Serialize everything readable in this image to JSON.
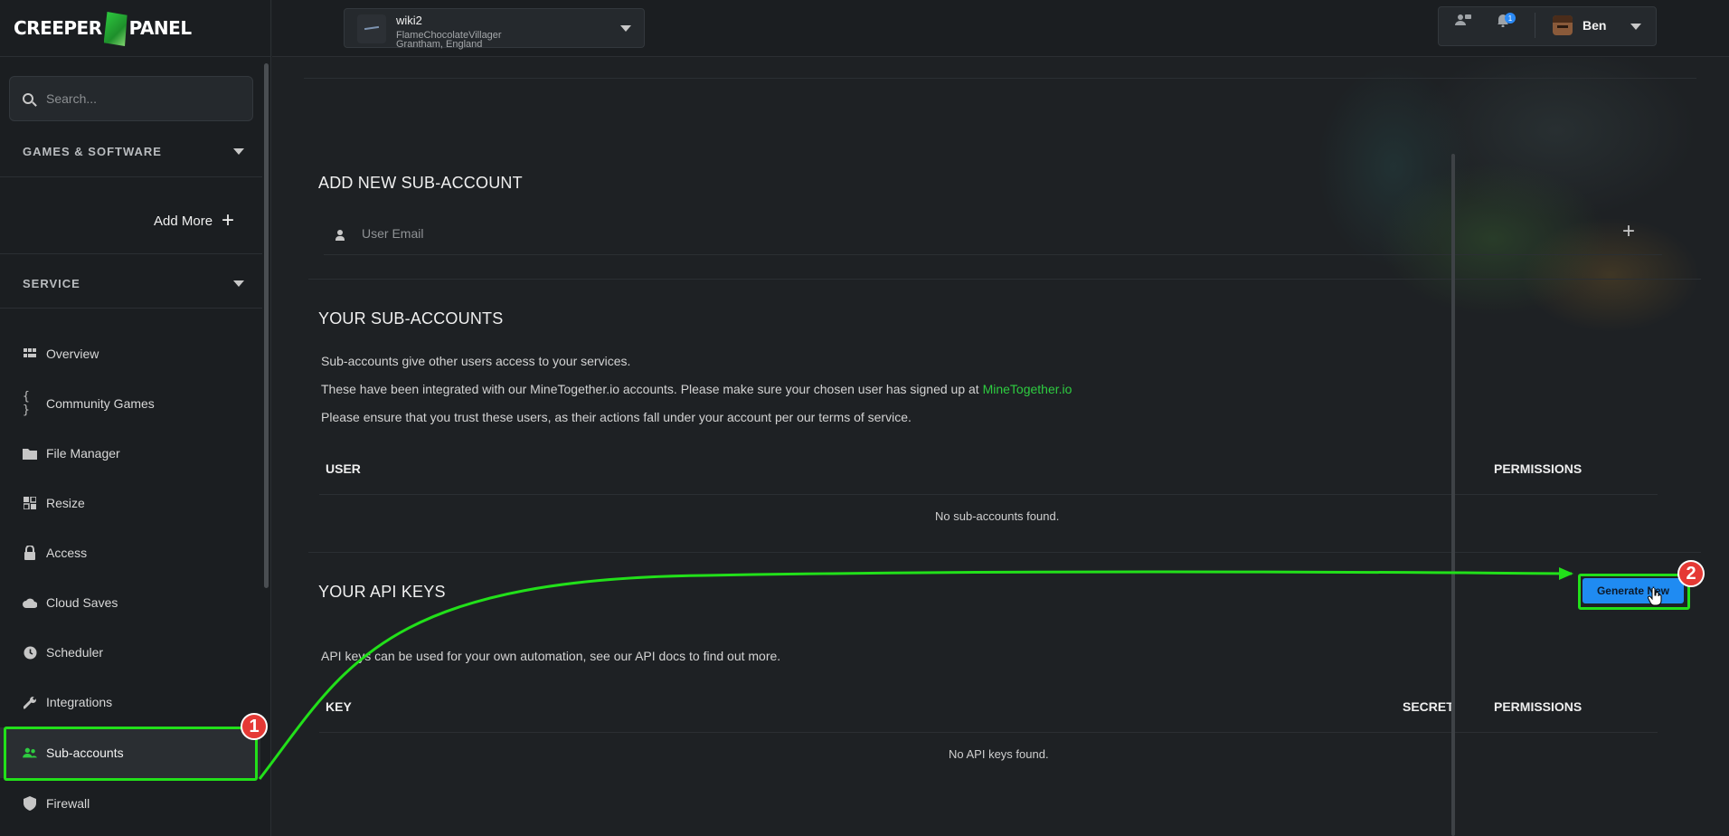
{
  "app": {
    "logo_left": "CREEPER",
    "logo_right": "PANEL"
  },
  "sidebar": {
    "search_placeholder": "Search...",
    "games_section": "GAMES & SOFTWARE",
    "add_more": "Add More",
    "service_section": "SERVICE",
    "items": [
      {
        "label": "Overview",
        "icon": "grid-icon"
      },
      {
        "label": "Community Games",
        "icon": "braces-icon"
      },
      {
        "label": "File Manager",
        "icon": "folder-icon"
      },
      {
        "label": "Resize",
        "icon": "resize-icon"
      },
      {
        "label": "Access",
        "icon": "lock-icon"
      },
      {
        "label": "Cloud Saves",
        "icon": "cloud-icon"
      },
      {
        "label": "Scheduler",
        "icon": "clock-icon"
      },
      {
        "label": "Integrations",
        "icon": "wrench-icon"
      },
      {
        "label": "Sub-accounts",
        "icon": "users-icon",
        "active": true
      },
      {
        "label": "Firewall",
        "icon": "shield-icon"
      }
    ]
  },
  "topbar": {
    "server_name": "wiki2",
    "server_line1": "FlameChocolateVillager",
    "server_line2": "Grantham, England",
    "notification_count": "1",
    "user_name": "Ben"
  },
  "main": {
    "add_title": "ADD NEW SUB-ACCOUNT",
    "email_placeholder": "User Email",
    "subs_title": "YOUR SUB-ACCOUNTS",
    "subs_p1": "Sub-accounts give other users access to your services.",
    "subs_p2": "These have been integrated with our MineTogether.io accounts. Please make sure your chosen user has signed up at ",
    "subs_p2_link": "MineTogether.io",
    "subs_p3": "Please ensure that you trust these users, as their actions fall under your account per our terms of service.",
    "subs_col_user": "USER",
    "subs_col_permissions": "PERMISSIONS",
    "subs_empty": "No sub-accounts found.",
    "api_title": "YOUR API KEYS",
    "api_button": "Generate New",
    "api_p": "API keys can be used for your own automation, see our API docs to find out more.",
    "api_col_key": "KEY",
    "api_col_secret": "SECRET",
    "api_col_permissions": "PERMISSIONS",
    "api_empty": "No API keys found."
  },
  "annotations": {
    "step1": "1",
    "step2": "2",
    "color": "#22e01a"
  },
  "colors": {
    "accent_green": "#2ecc40",
    "button_blue": "#1f8bf2",
    "bg": "#1e2124"
  }
}
